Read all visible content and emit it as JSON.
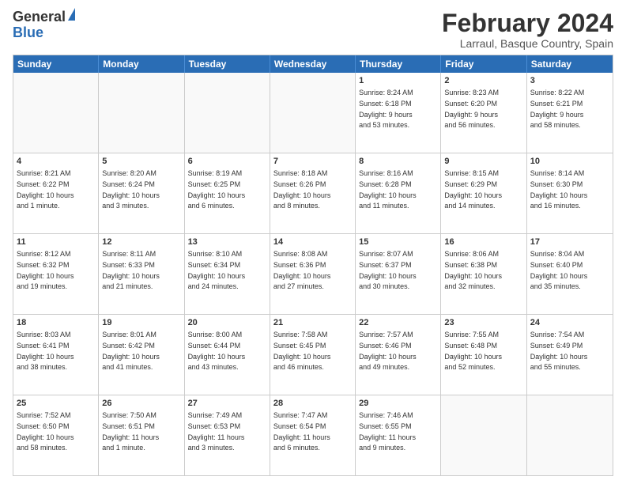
{
  "logo": {
    "general": "General",
    "blue": "Blue"
  },
  "title": "February 2024",
  "location": "Larraul, Basque Country, Spain",
  "days": [
    "Sunday",
    "Monday",
    "Tuesday",
    "Wednesday",
    "Thursday",
    "Friday",
    "Saturday"
  ],
  "weeks": [
    [
      {
        "day": "",
        "content": ""
      },
      {
        "day": "",
        "content": ""
      },
      {
        "day": "",
        "content": ""
      },
      {
        "day": "",
        "content": ""
      },
      {
        "day": "1",
        "content": "Sunrise: 8:24 AM\nSunset: 6:18 PM\nDaylight: 9 hours\nand 53 minutes."
      },
      {
        "day": "2",
        "content": "Sunrise: 8:23 AM\nSunset: 6:20 PM\nDaylight: 9 hours\nand 56 minutes."
      },
      {
        "day": "3",
        "content": "Sunrise: 8:22 AM\nSunset: 6:21 PM\nDaylight: 9 hours\nand 58 minutes."
      }
    ],
    [
      {
        "day": "4",
        "content": "Sunrise: 8:21 AM\nSunset: 6:22 PM\nDaylight: 10 hours\nand 1 minute."
      },
      {
        "day": "5",
        "content": "Sunrise: 8:20 AM\nSunset: 6:24 PM\nDaylight: 10 hours\nand 3 minutes."
      },
      {
        "day": "6",
        "content": "Sunrise: 8:19 AM\nSunset: 6:25 PM\nDaylight: 10 hours\nand 6 minutes."
      },
      {
        "day": "7",
        "content": "Sunrise: 8:18 AM\nSunset: 6:26 PM\nDaylight: 10 hours\nand 8 minutes."
      },
      {
        "day": "8",
        "content": "Sunrise: 8:16 AM\nSunset: 6:28 PM\nDaylight: 10 hours\nand 11 minutes."
      },
      {
        "day": "9",
        "content": "Sunrise: 8:15 AM\nSunset: 6:29 PM\nDaylight: 10 hours\nand 14 minutes."
      },
      {
        "day": "10",
        "content": "Sunrise: 8:14 AM\nSunset: 6:30 PM\nDaylight: 10 hours\nand 16 minutes."
      }
    ],
    [
      {
        "day": "11",
        "content": "Sunrise: 8:12 AM\nSunset: 6:32 PM\nDaylight: 10 hours\nand 19 minutes."
      },
      {
        "day": "12",
        "content": "Sunrise: 8:11 AM\nSunset: 6:33 PM\nDaylight: 10 hours\nand 21 minutes."
      },
      {
        "day": "13",
        "content": "Sunrise: 8:10 AM\nSunset: 6:34 PM\nDaylight: 10 hours\nand 24 minutes."
      },
      {
        "day": "14",
        "content": "Sunrise: 8:08 AM\nSunset: 6:36 PM\nDaylight: 10 hours\nand 27 minutes."
      },
      {
        "day": "15",
        "content": "Sunrise: 8:07 AM\nSunset: 6:37 PM\nDaylight: 10 hours\nand 30 minutes."
      },
      {
        "day": "16",
        "content": "Sunrise: 8:06 AM\nSunset: 6:38 PM\nDaylight: 10 hours\nand 32 minutes."
      },
      {
        "day": "17",
        "content": "Sunrise: 8:04 AM\nSunset: 6:40 PM\nDaylight: 10 hours\nand 35 minutes."
      }
    ],
    [
      {
        "day": "18",
        "content": "Sunrise: 8:03 AM\nSunset: 6:41 PM\nDaylight: 10 hours\nand 38 minutes."
      },
      {
        "day": "19",
        "content": "Sunrise: 8:01 AM\nSunset: 6:42 PM\nDaylight: 10 hours\nand 41 minutes."
      },
      {
        "day": "20",
        "content": "Sunrise: 8:00 AM\nSunset: 6:44 PM\nDaylight: 10 hours\nand 43 minutes."
      },
      {
        "day": "21",
        "content": "Sunrise: 7:58 AM\nSunset: 6:45 PM\nDaylight: 10 hours\nand 46 minutes."
      },
      {
        "day": "22",
        "content": "Sunrise: 7:57 AM\nSunset: 6:46 PM\nDaylight: 10 hours\nand 49 minutes."
      },
      {
        "day": "23",
        "content": "Sunrise: 7:55 AM\nSunset: 6:48 PM\nDaylight: 10 hours\nand 52 minutes."
      },
      {
        "day": "24",
        "content": "Sunrise: 7:54 AM\nSunset: 6:49 PM\nDaylight: 10 hours\nand 55 minutes."
      }
    ],
    [
      {
        "day": "25",
        "content": "Sunrise: 7:52 AM\nSunset: 6:50 PM\nDaylight: 10 hours\nand 58 minutes."
      },
      {
        "day": "26",
        "content": "Sunrise: 7:50 AM\nSunset: 6:51 PM\nDaylight: 11 hours\nand 1 minute."
      },
      {
        "day": "27",
        "content": "Sunrise: 7:49 AM\nSunset: 6:53 PM\nDaylight: 11 hours\nand 3 minutes."
      },
      {
        "day": "28",
        "content": "Sunrise: 7:47 AM\nSunset: 6:54 PM\nDaylight: 11 hours\nand 6 minutes."
      },
      {
        "day": "29",
        "content": "Sunrise: 7:46 AM\nSunset: 6:55 PM\nDaylight: 11 hours\nand 9 minutes."
      },
      {
        "day": "",
        "content": ""
      },
      {
        "day": "",
        "content": ""
      }
    ]
  ]
}
